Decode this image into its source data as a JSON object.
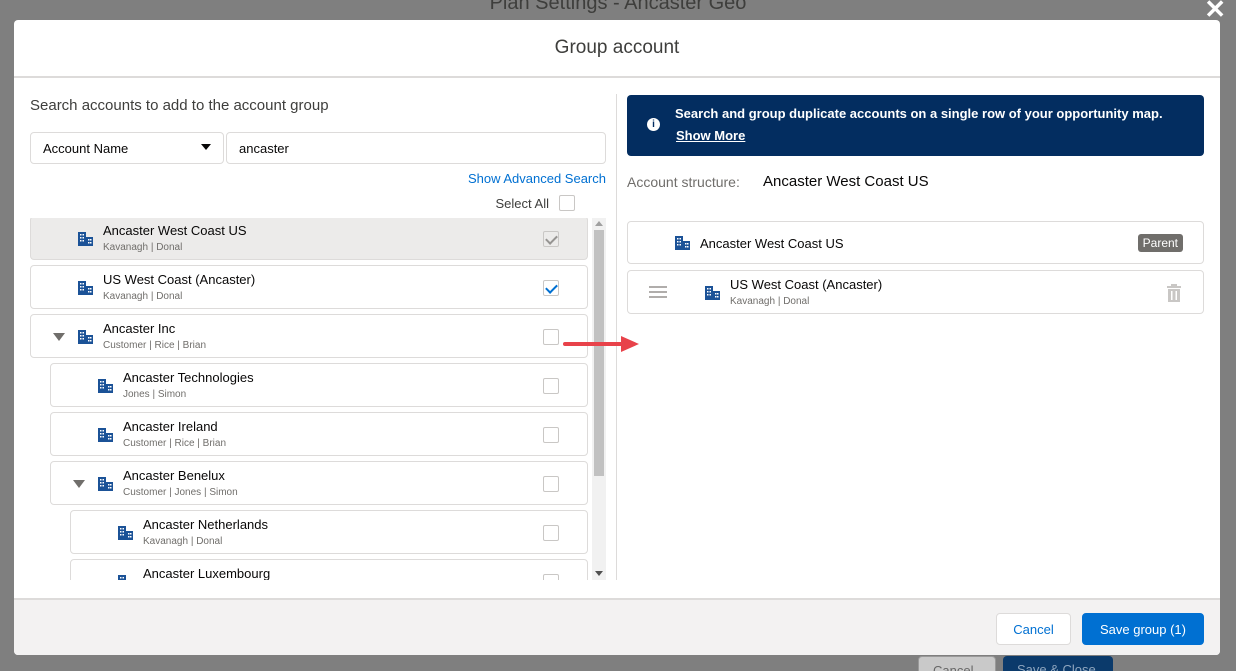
{
  "background": {
    "title": "Plan Settings - Ancaster Geo",
    "cancel_label": "Cancel",
    "save_close_label": "Save & Close"
  },
  "modal": {
    "title": "Group account",
    "left": {
      "search_title": "Search accounts to add to the account group",
      "field_select": "Account Name",
      "search_value": "ancaster",
      "advanced_search": "Show Advanced Search",
      "select_all": "Select All",
      "rows": [
        {
          "name": "Ancaster West Coast US",
          "sub": "Kavanagh | Donal",
          "checked": true,
          "disabled": true,
          "expandable": false,
          "level": 0
        },
        {
          "name": "US West Coast (Ancaster)",
          "sub": "Kavanagh | Donal",
          "checked": true,
          "disabled": false,
          "expandable": false,
          "level": 0
        },
        {
          "name": "Ancaster Inc",
          "sub": "Customer | Rice | Brian",
          "checked": false,
          "disabled": false,
          "expandable": true,
          "level": 0
        },
        {
          "name": "Ancaster Technologies",
          "sub": "Jones | Simon",
          "checked": false,
          "disabled": false,
          "expandable": false,
          "level": 1
        },
        {
          "name": "Ancaster Ireland",
          "sub": "Customer | Rice | Brian",
          "checked": false,
          "disabled": false,
          "expandable": false,
          "level": 1
        },
        {
          "name": "Ancaster Benelux",
          "sub": "Customer | Jones | Simon",
          "checked": false,
          "disabled": false,
          "expandable": true,
          "level": 1
        },
        {
          "name": "Ancaster Netherlands",
          "sub": "Kavanagh | Donal",
          "checked": false,
          "disabled": false,
          "expandable": false,
          "level": 2
        },
        {
          "name": "Ancaster Luxembourg",
          "sub": "",
          "checked": false,
          "disabled": false,
          "expandable": false,
          "level": 2
        }
      ]
    },
    "right": {
      "info_message": "Search and group duplicate accounts on a single row of your opportunity map.",
      "show_more": "Show More",
      "structure_label": "Account structure:",
      "structure_value": "Ancaster West Coast US",
      "parent": {
        "name": "Ancaster West Coast US",
        "badge": "Parent"
      },
      "child": {
        "name": "US West Coast (Ancaster)",
        "sub": "Kavanagh | Donal"
      }
    },
    "footer": {
      "cancel_label": "Cancel",
      "save_label": "Save group (1)"
    }
  },
  "colors": {
    "brand": "#0070d2",
    "banner": "#032d60",
    "arrow": "#e8424a"
  },
  "icons": [
    "close-icon",
    "building-icon",
    "info-icon",
    "drag-handle-icon",
    "trash-icon",
    "chevron-down-icon"
  ]
}
